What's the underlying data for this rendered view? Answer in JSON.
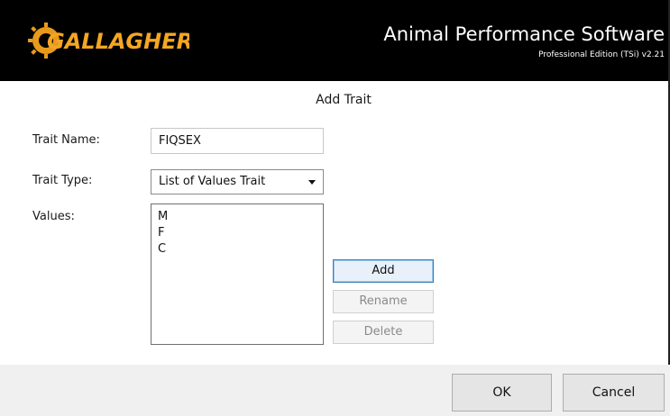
{
  "header": {
    "logo_text": "GALLAGHER",
    "app_title": "Animal Performance Software",
    "edition": "Professional Edition (TSi) v2.21",
    "logo_color": "#f5a623"
  },
  "dialog": {
    "title": "Add Trait",
    "trait_name_label": "Trait Name:",
    "trait_name_value": "FIQSEX",
    "trait_type_label": "Trait Type:",
    "trait_type_value": "List of Values Trait",
    "values_label": "Values:",
    "values": [
      "M",
      "F",
      "C"
    ],
    "add_label": "Add",
    "rename_label": "Rename",
    "delete_label": "Delete"
  },
  "footer": {
    "ok_label": "OK",
    "cancel_label": "Cancel"
  }
}
